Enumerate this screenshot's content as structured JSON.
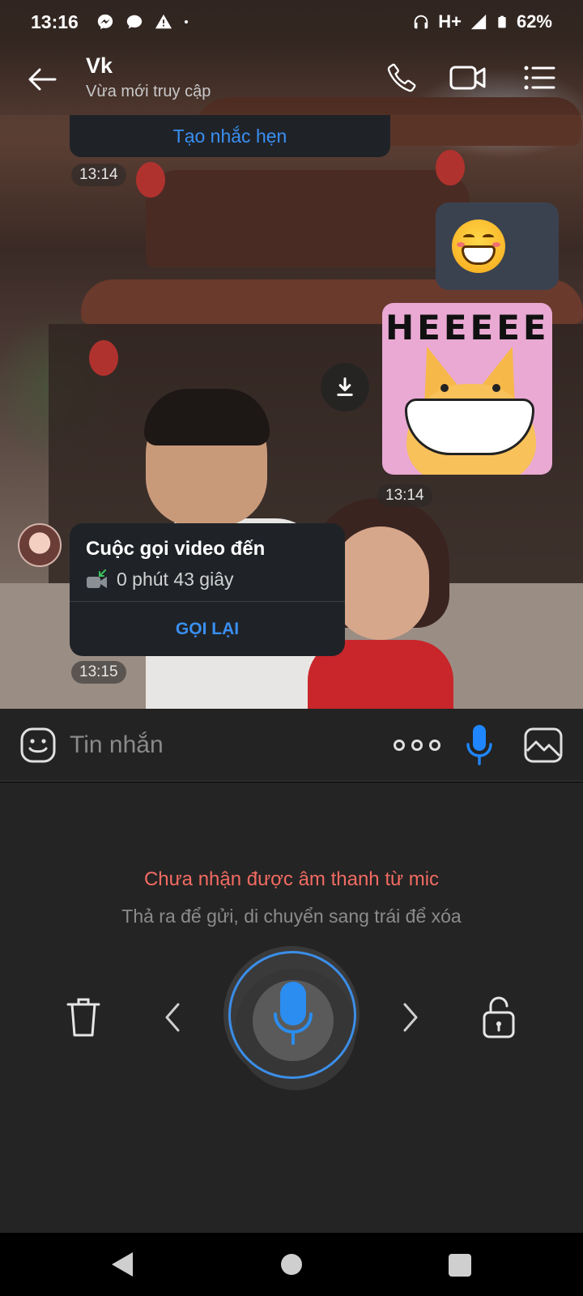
{
  "status_bar": {
    "time": "13:16",
    "network": "H+",
    "battery": "62%",
    "icons": [
      "messenger-icon",
      "chat-icon",
      "warning-icon",
      "dot-icon",
      "headphones-icon",
      "signal-icon",
      "battery-icon"
    ]
  },
  "header": {
    "contact_name": "Vk",
    "contact_status": "Vừa mới truy cập",
    "icons": [
      "back-arrow-icon",
      "phone-icon",
      "video-camera-icon",
      "menu-list-icon"
    ]
  },
  "messages": {
    "reminder_action": "Tạo nhắc hẹn",
    "time_1": "13:14",
    "time_2": "13:14",
    "sticker_text": "HEEEEE",
    "call": {
      "title": "Cuộc gọi video đến",
      "duration": "0 phút 43 giây",
      "action": "GỌI LẠI"
    },
    "time_3": "13:15"
  },
  "input_bar": {
    "placeholder": "Tin nhắn",
    "icons": [
      "emoji-icon",
      "more-dots-icon",
      "microphone-icon",
      "gallery-icon"
    ],
    "accent_color": "#3a8ff2"
  },
  "voice_panel": {
    "warning": "Chưa nhận được âm thanh từ mic",
    "hint": "Thả ra để gửi, di chuyển sang trái để xóa",
    "warning_color": "#f26b62",
    "icons": [
      "trash-icon",
      "chevron-left-icon",
      "microphone-icon",
      "chevron-right-icon",
      "lock-icon"
    ]
  },
  "nav_bar": {
    "icons": [
      "nav-back-icon",
      "nav-home-icon",
      "nav-recent-icon"
    ]
  }
}
